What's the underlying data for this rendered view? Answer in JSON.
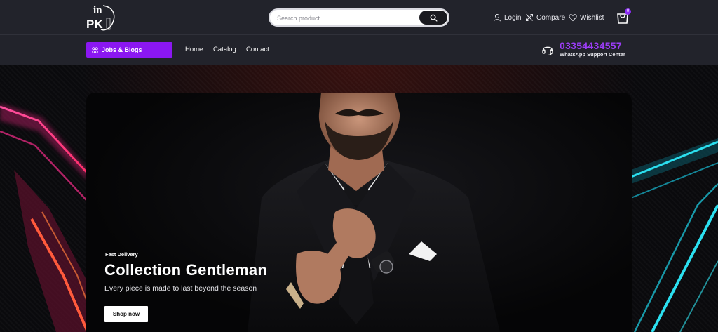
{
  "header": {
    "logo_text": "inPK",
    "search": {
      "placeholder": "Search product"
    },
    "links": {
      "login": "Login",
      "compare": "Compare",
      "wishlist": "Wishlist"
    },
    "cart_count": "0"
  },
  "nav": {
    "jobs_blogs": "Jobs & Blogs",
    "items": [
      "Home",
      "Catalog",
      "Contact"
    ],
    "support": {
      "phone": "03354434557",
      "label": "WhatsApp Support Center"
    }
  },
  "hero": {
    "eyebrow": "Fast Delivery",
    "title": "Collection Gentleman",
    "subtitle": "Every piece is made to last beyond the season",
    "cta": "Shop now"
  },
  "colors": {
    "accent": "#8b17f2",
    "phone": "#9b3cf6",
    "bar": "#22232b",
    "neon_left": "#ff3c8c",
    "neon_right": "#22d3e6"
  },
  "icons": [
    "search-icon",
    "user-icon",
    "compare-icon",
    "heart-icon",
    "cart-icon",
    "grid-icon",
    "headset-icon"
  ]
}
